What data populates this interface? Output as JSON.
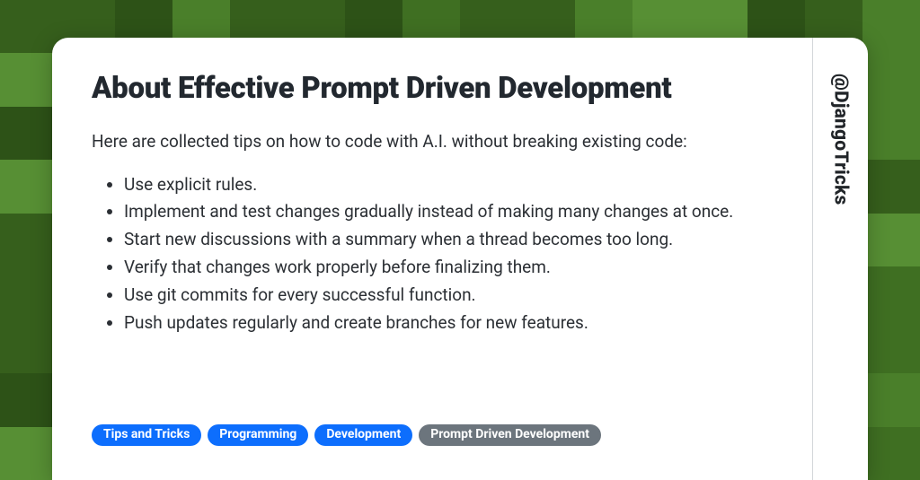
{
  "title": "About Effective Prompt Driven Development",
  "intro": "Here are collected tips on how to code with A.I. without breaking existing code:",
  "bullets": [
    "Use explicit rules.",
    "Implement and test changes gradually instead of making many changes at once.",
    "Start new discussions with a summary when a thread becomes too long.",
    "Verify that changes work properly before finalizing them.",
    "Use git commits for every successful function.",
    "Push updates regularly and create branches for new features."
  ],
  "tags": [
    {
      "label": "Tips and Tricks",
      "variant": "blue"
    },
    {
      "label": "Programming",
      "variant": "blue"
    },
    {
      "label": "Development",
      "variant": "blue"
    },
    {
      "label": "Prompt Driven Development",
      "variant": "grey"
    }
  ],
  "handle": "@DjangoTricks"
}
